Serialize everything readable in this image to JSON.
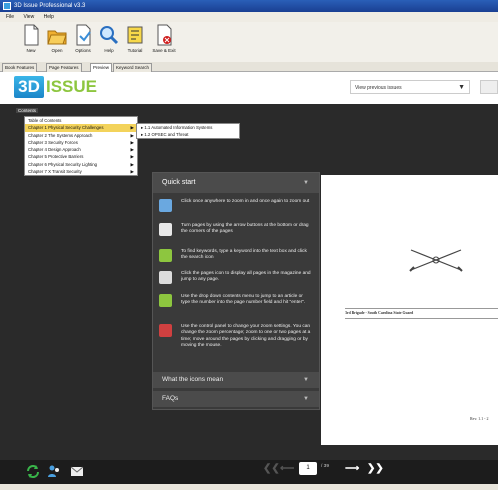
{
  "window": {
    "title": "3D Issue Professional v3.3"
  },
  "menu": [
    "File",
    "View",
    "Help"
  ],
  "toolbar": {
    "buttons": [
      {
        "label": "New"
      },
      {
        "label": "Open"
      },
      {
        "label": "Options"
      },
      {
        "label": "Help"
      },
      {
        "label": "Tutorial"
      },
      {
        "label": "Save & Exit"
      }
    ]
  },
  "tabs": [
    "Book Features",
    "Page Features",
    "Preview",
    "Keyword Search"
  ],
  "active_tab": "Preview",
  "logo": {
    "prefix": "3D",
    "word": "ISSUE"
  },
  "previous_issues": {
    "value": "View previous issues"
  },
  "contents": {
    "label": "Contents",
    "items": [
      {
        "label": "Table of Contents",
        "has_submenu": false
      },
      {
        "label": "Chapter 1 Physical Security Challenges",
        "has_submenu": true,
        "selected": true
      },
      {
        "label": "Chapter 2 The Systems Approach",
        "has_submenu": true
      },
      {
        "label": "Chapter 3 Security Forces",
        "has_submenu": true
      },
      {
        "label": "Chapter 4 Design Approach",
        "has_submenu": true
      },
      {
        "label": "Chapter 5 Protective Barriers",
        "has_submenu": true
      },
      {
        "label": "Chapter 6 Physical Security Lighting",
        "has_submenu": true
      },
      {
        "label": "Chapter 7 X Transit Security",
        "has_submenu": true
      }
    ],
    "submenu": [
      "▸ 1.1 Automated Information Systems",
      "▸ 1.2 OPSEC and Threat"
    ]
  },
  "quick_start": {
    "title": "Quick start",
    "items": [
      {
        "icon": "zoom-icon",
        "text": "Click once anywhere to zoom in and once again to zoom out"
      },
      {
        "icon": "page-turn-icon",
        "text": "Turn pages by using the arrow buttons at the bottom or drag the corners of the pages"
      },
      {
        "icon": "search-page-icon",
        "text": "To find keywords, type a keyword into the text box and click the search icon"
      },
      {
        "icon": "pages-icon",
        "text": "Click the pages icon to display all pages in the magazine and jump to any page."
      },
      {
        "icon": "contents-icon",
        "text": "Use the drop down contents menu to jump to an article or type the number into the page number field and hit \"enter\"."
      },
      {
        "icon": "control-panel-icon",
        "text": "Use the control panel to change your zoom settings. You can change the zoom percentage; zoom to one or two pages at a time; move around the pages by clicking and dragging or by moving the mouse."
      }
    ],
    "footer_1": "What the icons mean",
    "footer_2": "FAQs"
  },
  "document": {
    "caption": "3rd Brigade - South Carolina State Guard",
    "footer": "Rev. 1.1 - 2"
  },
  "navigation": {
    "current_page": "1",
    "total": "/ 39"
  },
  "colors": {
    "accent": "#1c86c9",
    "highlight": "#f3d35b",
    "viewer_bg": "#2a2a2a",
    "panel_bg": "#3a3a3a"
  }
}
